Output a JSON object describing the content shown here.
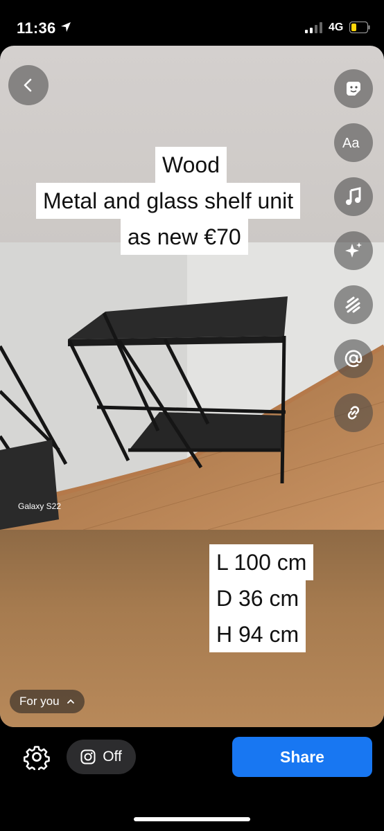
{
  "status_bar": {
    "time": "11:36",
    "network": "4G"
  },
  "story": {
    "caption_lines": [
      "Wood",
      "Metal and glass shelf unit",
      "as new €70"
    ],
    "dimensions": [
      "L 100 cm",
      "D 36 cm",
      "H 94 cm"
    ],
    "photo_watermark": "Galaxy S22",
    "audience_label": "For you"
  },
  "tools": [
    "sticker-icon",
    "text-icon",
    "music-icon",
    "effects-icon",
    "draw-icon",
    "mention-icon",
    "link-icon"
  ],
  "bottom_bar": {
    "toggle_label": "Off",
    "share_label": "Share"
  },
  "colors": {
    "share_button": "#1877f2",
    "toggle_bg": "#2c2c2e"
  }
}
